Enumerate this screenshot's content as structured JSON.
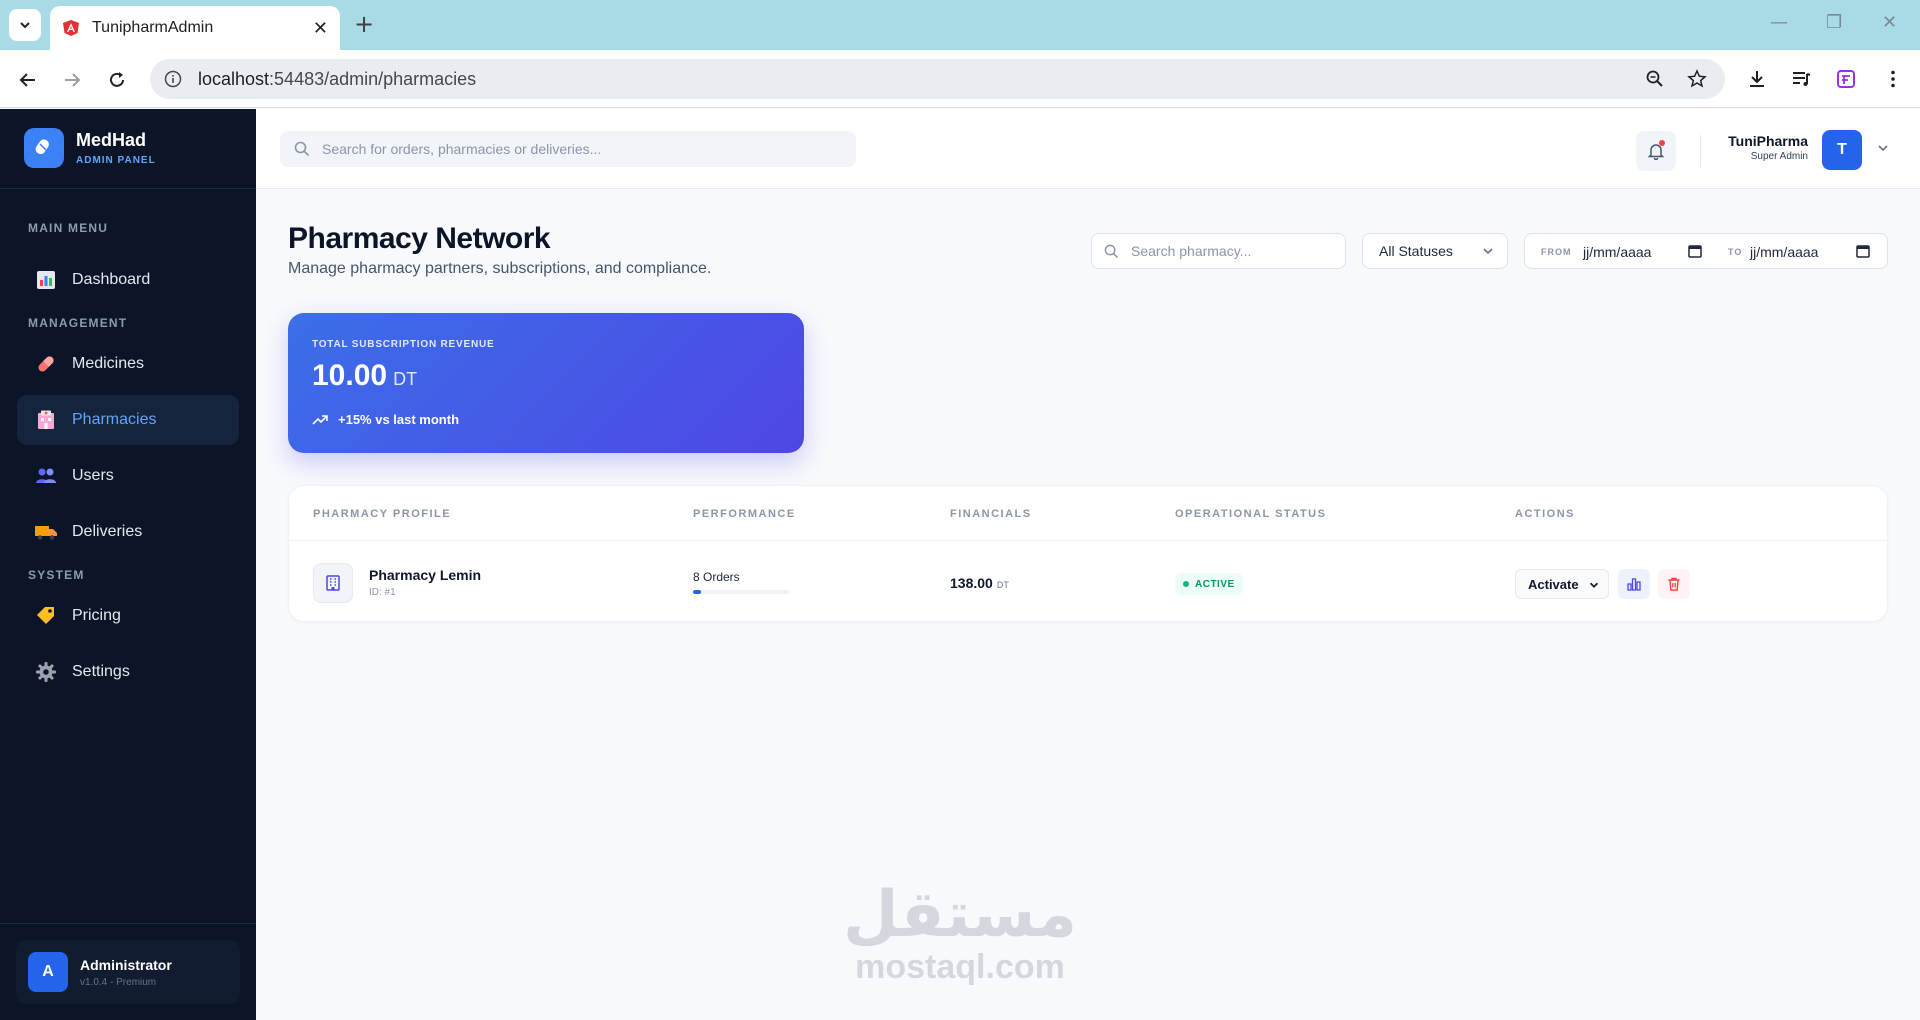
{
  "browser": {
    "tab_title": "TunipharmAdmin",
    "url_host": "localhost",
    "url_path": ":54483/admin/pharmacies"
  },
  "sidebar": {
    "brand_name": "MedHad",
    "brand_sub": "ADMIN PANEL",
    "sections": {
      "main": "MAIN MENU",
      "management": "MANAGEMENT",
      "system": "SYSTEM"
    },
    "items": [
      {
        "label": "Dashboard",
        "icon": "bar-chart-icon"
      },
      {
        "label": "Medicines",
        "icon": "pill-icon"
      },
      {
        "label": "Pharmacies",
        "icon": "hospital-icon",
        "active": true
      },
      {
        "label": "Users",
        "icon": "users-icon"
      },
      {
        "label": "Deliveries",
        "icon": "truck-icon"
      },
      {
        "label": "Pricing",
        "icon": "tag-icon"
      },
      {
        "label": "Settings",
        "icon": "gear-icon"
      }
    ],
    "admin": {
      "initial": "A",
      "name": "Administrator",
      "version": "v1.0.4 - Premium"
    }
  },
  "header": {
    "search_placeholder": "Search for orders, pharmacies or deliveries...",
    "user_name": "TuniPharma",
    "user_role": "Super Admin",
    "user_initial": "T"
  },
  "page": {
    "title": "Pharmacy Network",
    "subtitle": "Manage pharmacy partners, subscriptions, and compliance.",
    "filters": {
      "search_placeholder": "Search pharmacy...",
      "status": "All Statuses",
      "from_label": "FROM",
      "from_value": "jj/mm/aaaa",
      "to_label": "TO",
      "to_value": "jj/mm/aaaa"
    },
    "revenue": {
      "label": "TOTAL SUBSCRIPTION REVENUE",
      "value": "10.00",
      "unit": "DT",
      "trend": "+15% vs last month"
    },
    "table": {
      "headers": [
        "PHARMACY PROFILE",
        "PERFORMANCE",
        "FINANCIALS",
        "OPERATIONAL STATUS",
        "ACTIONS"
      ],
      "rows": [
        {
          "name": "Pharmacy Lemin",
          "id": "ID: #1",
          "orders": "8 Orders",
          "orders_progress": 0.08,
          "amount": "138.00",
          "unit": "DT",
          "status": "ACTIVE",
          "action": "Activate"
        }
      ]
    }
  },
  "watermark": {
    "arabic": "مستقل",
    "latin": "mostaql.com"
  },
  "colors": {
    "accent": "#2563eb",
    "sidebar": "#0c1527",
    "active_text": "#60a5fa",
    "success": "#059669",
    "danger": "#ef4444"
  }
}
